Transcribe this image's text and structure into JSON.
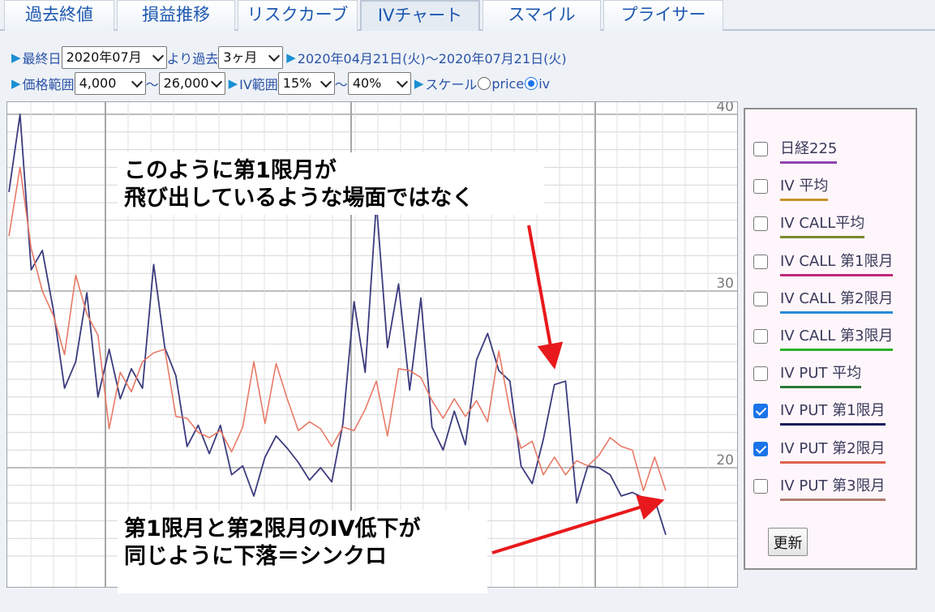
{
  "tabs": [
    {
      "label": "過去終値",
      "active": false
    },
    {
      "label": "損益推移",
      "active": false
    },
    {
      "label": "リスクカーブ",
      "active": false
    },
    {
      "label": "IVチャート",
      "active": true
    },
    {
      "label": "スマイル",
      "active": false
    },
    {
      "label": "プライサー",
      "active": false
    }
  ],
  "controls": {
    "last_day_label": "最終日",
    "last_day_value": "2020年07月",
    "period_label": "より過去",
    "period_value": "3ヶ月",
    "range_text": "2020年04月21日(火)～2020年07月21日(火)",
    "price_range_label": "価格範囲",
    "price_min": "4,000",
    "price_max": "26,000",
    "tilde": "～",
    "iv_range_label": "IV範囲",
    "iv_min": "15%",
    "iv_max": "40%",
    "scale_label": "スケール",
    "scale_price": "price",
    "scale_iv": "iv",
    "scale_selected": "iv"
  },
  "annotations": {
    "top": [
      "このように第1限月が",
      "飛び出しているような場面ではなく"
    ],
    "bottom": [
      "第1限月と第2限月のIV低下が",
      "同じように下落＝シンクロ"
    ],
    "arrow_color": "#e8191c"
  },
  "legend": {
    "items": [
      {
        "label": "日経225",
        "checked": false,
        "color": "#8e44ad"
      },
      {
        "label": "IV 平均",
        "checked": false,
        "color": "#c8902a"
      },
      {
        "label": "IV CALL平均",
        "checked": false,
        "color": "#7a8a2a"
      },
      {
        "label": "IV CALL 第1限月",
        "checked": false,
        "color": "#c0287a"
      },
      {
        "label": "IV CALL 第2限月",
        "checked": false,
        "color": "#2a8ad8"
      },
      {
        "label": "IV CALL 第3限月",
        "checked": false,
        "color": "#2ab02a"
      },
      {
        "label": "IV PUT 平均",
        "checked": false,
        "color": "#2a7a3a"
      },
      {
        "label": "IV PUT 第1限月",
        "checked": true,
        "color": "#1a1a5e"
      },
      {
        "label": "IV PUT 第2限月",
        "checked": true,
        "color": "#e06050"
      },
      {
        "label": "IV PUT 第3限月",
        "checked": false,
        "color": "#b07a70"
      }
    ],
    "update_button": "更新"
  },
  "chart_data": {
    "type": "line",
    "x_start": "2020-04-21",
    "x_end": "2020-07-21",
    "ylim": [
      15,
      40
    ],
    "y_ticks": [
      "40",
      "30",
      "20"
    ],
    "y_tick_values": [
      40,
      30,
      20
    ],
    "grid": true,
    "series": [
      {
        "name": "IV PUT 第1限月",
        "color": "#3b3b7e",
        "values": [
          35.6,
          40.0,
          31.2,
          32.3,
          28.9,
          24.5,
          26.0,
          29.9,
          24.0,
          26.7,
          23.9,
          25.6,
          24.5,
          31.5,
          26.8,
          25.2,
          21.2,
          22.4,
          20.8,
          22.4,
          19.6,
          20.1,
          18.4,
          20.6,
          21.8,
          21.1,
          20.3,
          19.3,
          20.0,
          19.2,
          22.5,
          29.4,
          25.4,
          35.0,
          26.8,
          30.4,
          24.4,
          29.6,
          22.3,
          21.0,
          23.2,
          21.3,
          26.1,
          27.6,
          25.5,
          24.9,
          20.1,
          19.1,
          21.6,
          24.7,
          24.9,
          18.0,
          20.1,
          20.0,
          19.6,
          18.4,
          18.6,
          18.3,
          18.2,
          16.2
        ]
      },
      {
        "name": "IV PUT 第2限月",
        "color": "#e87a66",
        "values": [
          33.1,
          37.0,
          32.4,
          30.0,
          28.6,
          26.4,
          30.9,
          28.7,
          27.5,
          22.2,
          25.4,
          24.3,
          26.0,
          26.5,
          26.7,
          22.9,
          22.8,
          22.0,
          21.7,
          22.1,
          20.9,
          22.3,
          26.0,
          22.5,
          25.9,
          23.9,
          22.1,
          22.6,
          22.2,
          21.2,
          22.3,
          22.1,
          23.3,
          24.9,
          21.8,
          25.6,
          25.5,
          25.1,
          23.8,
          22.8,
          23.9,
          22.9,
          23.8,
          22.6,
          26.6,
          23.2,
          21.1,
          21.5,
          19.6,
          20.6,
          19.6,
          20.4,
          20.1,
          20.7,
          21.7,
          21.2,
          21.0,
          18.7,
          20.6,
          18.7
        ]
      }
    ]
  }
}
